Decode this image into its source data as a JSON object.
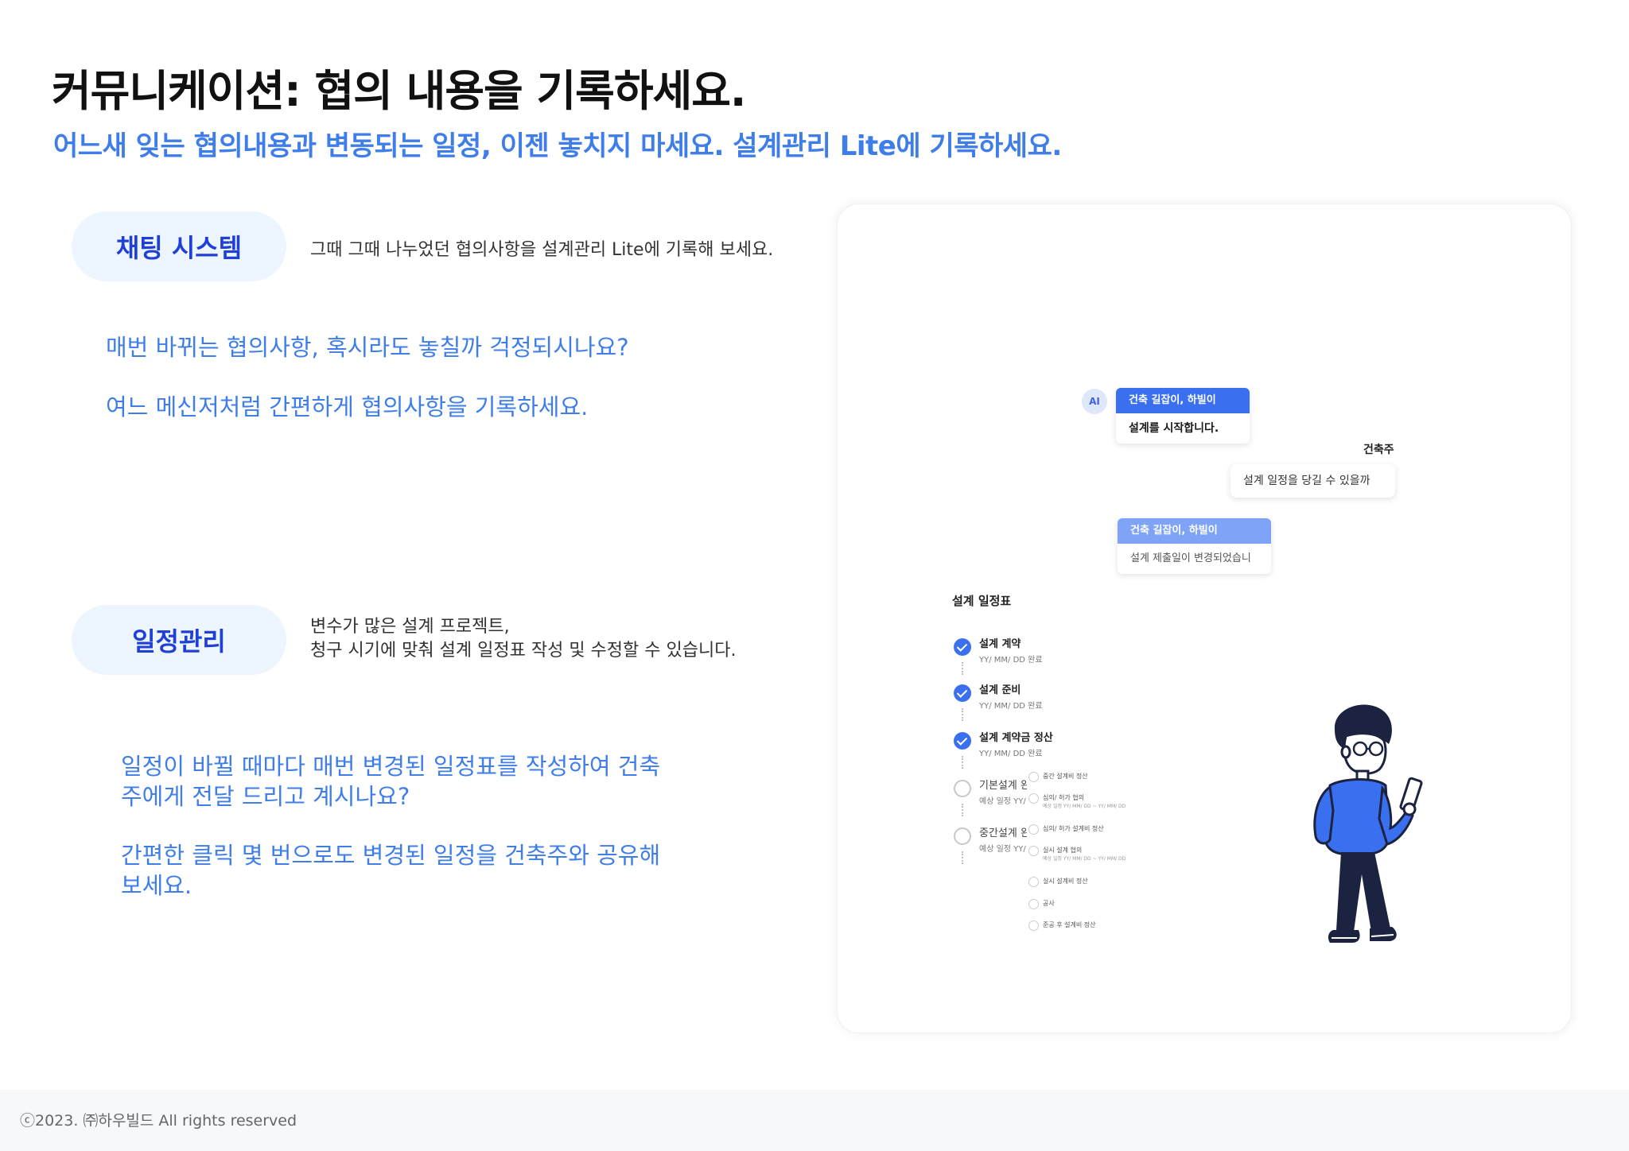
{
  "header": {
    "title": "커뮤니케이션: 협의 내용을 기록하세요.",
    "subtitle": "어느새 잊는 협의내용과 변동되는 일정, 이젠 놓치지 마세요. 설계관리 Lite에 기록하세요."
  },
  "features": [
    {
      "label": "채팅 시스템",
      "description": "그때 그때 나누었던 협의사항을 설계관리 Lite에 기록해 보세요.",
      "callouts": [
        "매번 바뀌는 협의사항, 혹시라도 놓칠까 걱정되시나요?",
        "여느 메신저처럼 간편하게 협의사항을 기록하세요."
      ]
    },
    {
      "label": "일정관리",
      "description_lines": [
        "변수가 많은 설계 프로젝트,",
        "청구 시기에 맞춰 설계 일정표 작성 및 수정할 수 있습니다."
      ],
      "callouts": [
        "일정이 바뀔 때마다 매번 변경된 일정표를 작성하여 건축주에게 전달 드리고 계시나요?",
        "간편한 클릭 몇 번으로도 변경된 일정을 건축주와 공유해보세요."
      ]
    }
  ],
  "preview": {
    "chat": {
      "ai_badge": "AI",
      "message_1": {
        "sender": "건축 길잡이, 하빌이",
        "text": "설계를 시작합니다."
      },
      "client_label": "건축주",
      "message_2": {
        "text": "설계 일정을 당길 수 있을까요?"
      },
      "message_3": {
        "sender": "건축 길잡이, 하빌이",
        "text": "설계 제출일이 변경되었습니다."
      }
    },
    "schedule": {
      "title": "설계 일정표",
      "items": [
        {
          "name": "설계 계약",
          "date": "YY/ MM/ DD 완료",
          "status": "done"
        },
        {
          "name": "설계 준비",
          "date": "YY/ MM/ DD 완료",
          "status": "done"
        },
        {
          "name": "설계 계약금 정산",
          "date": "YY/ MM/ DD 완료",
          "status": "done"
        },
        {
          "name": "기본설계 완",
          "date": "예상 일정 YY/",
          "status": "todo"
        },
        {
          "name": "중간설계 완",
          "date": "예상 일정 YY/",
          "status": "todo"
        }
      ],
      "sub_items": [
        {
          "name": "중간 설계비 정산",
          "date": ""
        },
        {
          "name": "심의/ 허가 협의",
          "date": "예상 일정 YY/ MM/ DD ~ YY/ MM/ DD"
        },
        {
          "name": "심의/ 허가 설계비 정산",
          "date": ""
        },
        {
          "name": "실시 설계 협의",
          "date": "예상 일정 YY/ MM/ DD ~ YY/ MM/ DD"
        },
        {
          "name": "실시 설계비 정산",
          "date": ""
        },
        {
          "name": "공사",
          "date": ""
        },
        {
          "name": "준공 후 설계비 정산",
          "date": ""
        }
      ]
    }
  },
  "footer": {
    "copyright": "ⓒ2023. ㈜하우빌드 All rights reserved"
  },
  "colors": {
    "accent": "#3f7ee8",
    "pill_text": "#1f3fd6",
    "pill_bg": "#edf5ff",
    "chat_blue": "#3a6ff0",
    "chat_light_blue": "#7fa4f7"
  }
}
